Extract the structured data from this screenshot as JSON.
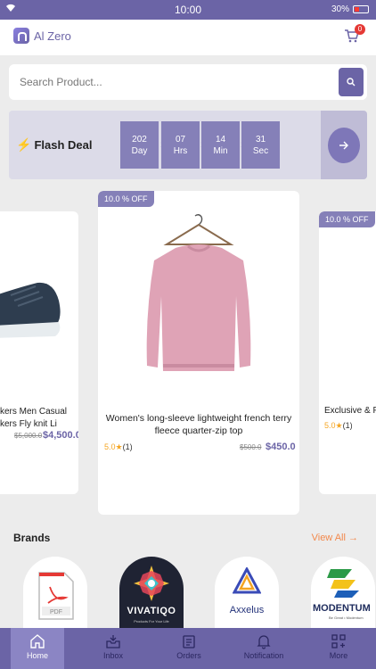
{
  "status_bar": {
    "time": "10:00",
    "battery": "30%"
  },
  "header": {
    "app_title": "Al Zero",
    "cart_count": "0"
  },
  "search": {
    "placeholder": "Search Product..."
  },
  "flash_deal": {
    "title": "Flash Deal",
    "countdown": [
      {
        "value": "202",
        "unit": "Day"
      },
      {
        "value": "07",
        "unit": "Hrs"
      },
      {
        "value": "14",
        "unit": "Min"
      },
      {
        "value": "31",
        "unit": "Sec"
      }
    ]
  },
  "products": [
    {
      "name_line1": "kers Men Casual",
      "name_line2": "kers Fly knit Li",
      "old_price": "$5,000.0",
      "price": "$4,500.0"
    },
    {
      "discount": "10.0 % OFF",
      "name_line1": "Women's long-sleeve lightweight french terry",
      "name_line2": "fleece quarter-zip top",
      "rating": "5.0",
      "reviews": "(1)",
      "old_price": "$500.0",
      "price": "$450.0"
    },
    {
      "discount": "10.0 % OFF",
      "name_line1": "Exclusive & F",
      "rating": "5.0",
      "reviews": "(1)"
    }
  ],
  "brands": {
    "title": "Brands",
    "view_all": "View All",
    "items": [
      {
        "label": "PDF"
      },
      {
        "label": "VIVATIQO",
        "tagline": "Products For Your Life"
      },
      {
        "label": "Axxelus"
      },
      {
        "label": "MODENTUM",
        "tagline": "Be Great • Modentum"
      }
    ]
  },
  "bottom_nav": [
    {
      "label": "Home",
      "icon": "home-icon",
      "active": true
    },
    {
      "label": "Inbox",
      "icon": "inbox-icon"
    },
    {
      "label": "Orders",
      "icon": "orders-icon"
    },
    {
      "label": "Notification",
      "icon": "bell-icon"
    },
    {
      "label": "More",
      "icon": "grid-icon"
    }
  ]
}
